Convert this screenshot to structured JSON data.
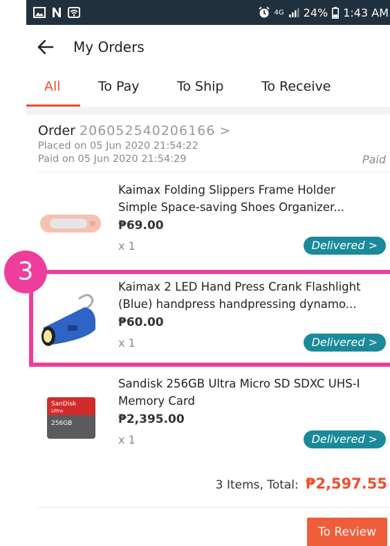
{
  "status_bar": {
    "network": "4G",
    "battery": "24%",
    "time": "1:43 AM",
    "icons": [
      "gallery-icon",
      "n-icon",
      "wifi-icon",
      "alarm-icon",
      "signal-icon",
      "battery-icon"
    ]
  },
  "header": {
    "title": "My Orders"
  },
  "tabs": [
    {
      "label": "All",
      "active": true
    },
    {
      "label": "To Pay"
    },
    {
      "label": "To Ship"
    },
    {
      "label": "To Receive"
    }
  ],
  "order": {
    "order_label": "Order",
    "order_number": "206052540206166",
    "chevron": ">",
    "placed": "Placed on 05 Jun 2020  21:54:22",
    "paid_on": "Paid on 05 Jun 2020  21:54:29",
    "status": "Paid"
  },
  "items": [
    {
      "name_line1": "Kaimax Folding Slippers Frame Holder",
      "name_line2": "Simple Space-saving Shoes Organizer...",
      "price": "₱69.00",
      "qty": "x 1",
      "status": "Delivered >"
    },
    {
      "name_line1": "Kaimax 2 LED Hand Press Crank Flashlight",
      "name_line2": "(Blue) handpress handpressing dynamo...",
      "price": "₱60.00",
      "qty": "x 1",
      "status": "Delivered >"
    },
    {
      "name_line1": "Sandisk 256GB Ultra Micro SD SDXC UHS-I",
      "name_line2": "Memory Card",
      "price": "₱2,395.00",
      "qty": "x 1",
      "status": "Delivered >"
    }
  ],
  "summary": {
    "label": "3 Items, Total:",
    "amount": "₱2,597.55"
  },
  "actions": {
    "review": "To Review"
  },
  "annotation": {
    "number": "3"
  },
  "colors": {
    "accent": "#ee4d2d",
    "status_bar": "#20303d",
    "delivered": "#1a8a9a",
    "highlight": "#ee3d9c"
  }
}
